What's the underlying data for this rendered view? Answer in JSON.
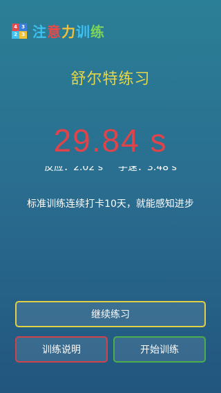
{
  "app": {
    "title_chars": [
      "注",
      "意",
      "力",
      "训",
      "练"
    ],
    "title_colors": [
      "#3ec1f0",
      "#e14b4b",
      "#f0c23c",
      "#3ec1f0",
      "#7cd45a"
    ],
    "logo_cells": [
      {
        "label": "4",
        "color": "#e14b4b"
      },
      {
        "label": "3",
        "color": "#3a7fd9"
      },
      {
        "label": "2",
        "color": "#3ec1f0"
      },
      {
        "label": "3",
        "color": "#f0c23c"
      }
    ]
  },
  "exercise": {
    "title": "舒尔特练习",
    "time": "29.84 s",
    "reaction": "反应：2.02 s",
    "speed": "手速：3.48 s",
    "hint": "标准训练连续打卡10天，就能感知进步"
  },
  "buttons": {
    "continue": "继续练习",
    "help": "训练说明",
    "start": "开始训练"
  },
  "colors": {
    "title_yellow": "#e6d64a",
    "time_red": "#e0434a",
    "continue_border": "#e2d243",
    "help_border": "#d2424a",
    "start_border": "#4cae4c"
  }
}
